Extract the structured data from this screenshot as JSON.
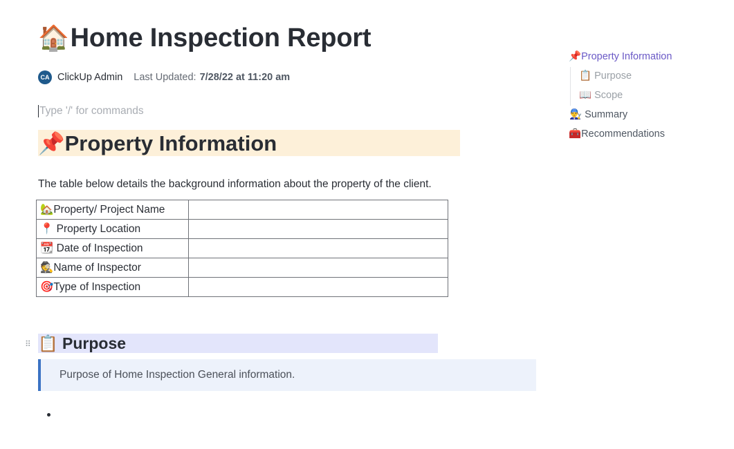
{
  "document": {
    "title_emoji": "🏠",
    "title": "Home Inspection Report",
    "author_initials": "CA",
    "author": "ClickUp Admin",
    "last_updated_label": "Last Updated:",
    "last_updated_value": "7/28/22 at 11:20 am",
    "editor_placeholder": "Type '/' for commands"
  },
  "property_section": {
    "heading_emoji": "📌",
    "heading": "Property Information",
    "intro": "The table below details the background information about the property of the client.",
    "rows": [
      {
        "icon": "🏡",
        "label": "Property/ Project Name",
        "value": ""
      },
      {
        "icon": "📍",
        "label": " Property Location",
        "value": ""
      },
      {
        "icon": "📆",
        "label": " Date of Inspection",
        "value": ""
      },
      {
        "icon": "🕵️",
        "label": "Name of Inspector",
        "value": ""
      },
      {
        "icon": "🎯",
        "label": "Type of Inspection",
        "value": ""
      }
    ]
  },
  "purpose_section": {
    "heading_emoji": "📋",
    "heading": "Purpose",
    "callout": "Purpose of Home Inspection General information."
  },
  "toc": [
    {
      "emoji": "📌",
      "label": "Property Information",
      "state": "active"
    },
    {
      "emoji": "📋",
      "label": "Purpose",
      "state": "sub"
    },
    {
      "emoji": "📖",
      "label": "Scope",
      "state": "sub"
    },
    {
      "emoji": "👨‍🔧",
      "label": "Summary",
      "state": "top"
    },
    {
      "emoji": "🧰",
      "label": "Recommendations",
      "state": "top"
    }
  ],
  "colors": {
    "accent": "#6a59c6",
    "property_heading_bg": "#fdf0d9",
    "purpose_heading_bg": "#e3e5fb",
    "callout_bg": "#edf2fb",
    "callout_border": "#3b73c4",
    "avatar_bg": "#1f5a8c"
  }
}
